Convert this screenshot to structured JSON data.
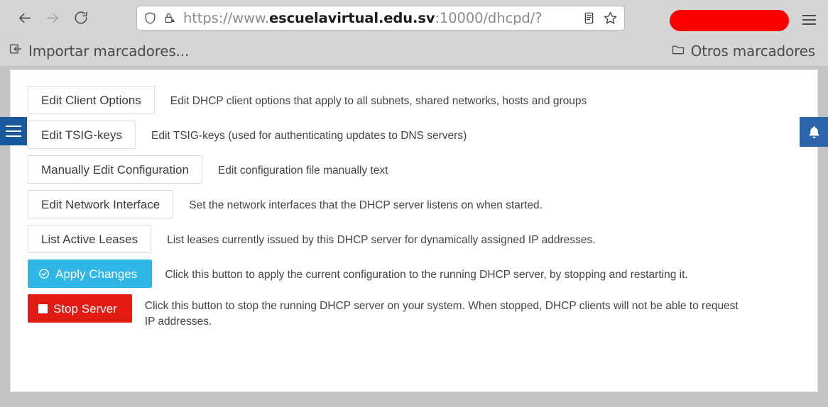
{
  "browser": {
    "nav": {
      "back_icon": "arrow-left-icon",
      "forward_icon": "arrow-right-icon",
      "reload_icon": "reload-icon"
    },
    "urlbar": {
      "shield_icon": "shield-icon",
      "lock_warning_icon": "lock-warning-icon",
      "url_scheme": "https://www.",
      "url_host": "escuelavirtual.edu.sv",
      "url_rest": ":10000/dhcpd/?",
      "reader_icon": "reader-view-icon",
      "bookmark_icon": "star-icon"
    },
    "profile_pill": "redacted-profile-pill",
    "app_menu_icon": "hamburger-menu-icon"
  },
  "bookmarks": {
    "import_icon": "import-bookmarks-icon",
    "import_label": "Importar marcadores...",
    "other_icon": "folder-icon",
    "other_label": "Otros marcadores"
  },
  "side": {
    "left_toggle_icon": "hamburger-menu-icon",
    "right_notify_icon": "bell-icon"
  },
  "colors": {
    "apply_blue": "#30b7e8",
    "stop_red": "#e21b12",
    "side_tab_blue": "#2c63ad",
    "chrome_gray": "#d5d5d5"
  },
  "main": {
    "rows": [
      {
        "button": "Edit Client Options",
        "description": "Edit DHCP client options that apply to all subnets, shared networks, hosts and groups",
        "style": "plain",
        "icon": ""
      },
      {
        "button": "Edit TSIG-keys",
        "description": "Edit TSIG-keys (used for authenticating updates to DNS servers)",
        "style": "plain",
        "icon": ""
      },
      {
        "button": "Manually Edit Configuration",
        "description": "Edit configuration file manually text",
        "style": "plain",
        "icon": ""
      },
      {
        "button": "Edit Network Interface",
        "description": "Set the network interfaces that the DHCP server listens on when started.",
        "style": "plain",
        "icon": ""
      },
      {
        "button": "List Active Leases",
        "description": "List leases currently issued by this DHCP server for dynamically assigned IP addresses.",
        "style": "plain",
        "icon": ""
      },
      {
        "button": "Apply Changes",
        "description": "Click this button to apply the current configuration to the running DHCP server, by stopping and restarting it.",
        "style": "apply",
        "icon": "check-circle-icon"
      },
      {
        "button": "Stop Server",
        "description": "Click this button to stop the running DHCP server on your system. When stopped, DHCP clients will not be able to request IP addresses.",
        "style": "stop",
        "icon": "stop-square-icon"
      }
    ]
  }
}
